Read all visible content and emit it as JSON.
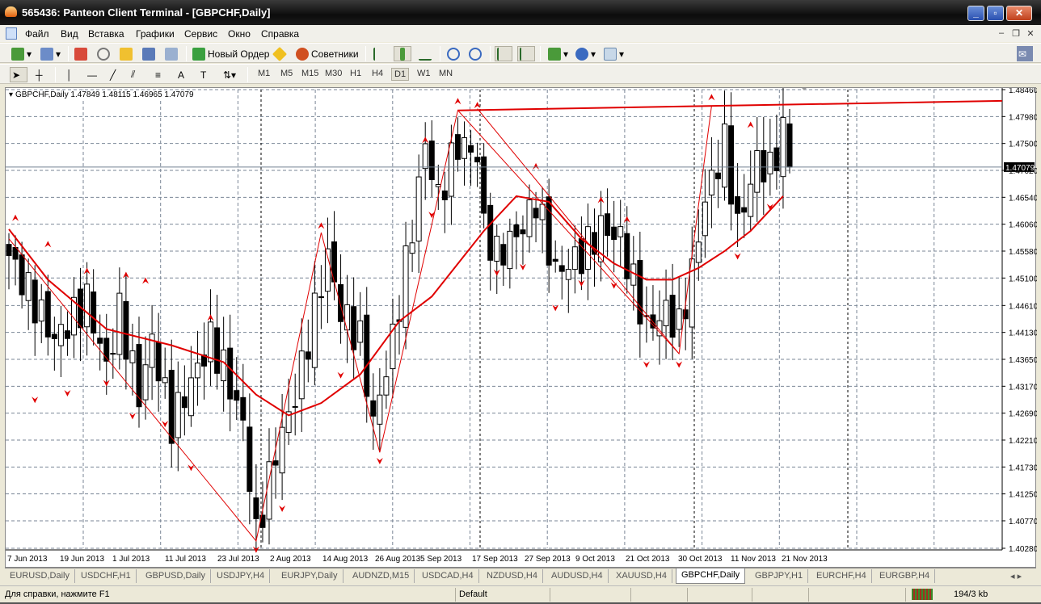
{
  "window": {
    "title": "565436: Panteon Client Terminal - [GBPCHF,Daily]"
  },
  "menu": [
    "Файл",
    "Вид",
    "Вставка",
    "Графики",
    "Сервис",
    "Окно",
    "Справка"
  ],
  "toolbar": {
    "new_order": "Новый Ордер",
    "experts": "Советники"
  },
  "timeframes": [
    "M1",
    "M5",
    "M15",
    "M30",
    "H1",
    "H4",
    "D1",
    "W1",
    "MN"
  ],
  "active_timeframe": "D1",
  "chart_header": "GBPCHF,Daily  1.47849 1.48115 1.46965 1.47079",
  "status": {
    "help": "Для справки, нажмите F1",
    "profile": "Default",
    "traffic": "194/3 kb"
  },
  "tabs": [
    "EURUSD,Daily",
    "USDCHF,H1",
    "GBPUSD,Daily",
    "USDJPY,H4",
    "EURJPY,Daily",
    "AUDNZD,M15",
    "USDCAD,H4",
    "NZDUSD,H4",
    "AUDUSD,H4",
    "XAUUSD,H4",
    "GBPCHF,Daily",
    "GBPJPY,H1",
    "EURCHF,H4",
    "EURGBP,H4"
  ],
  "active_tab": "GBPCHF,Daily",
  "chart_data": {
    "type": "candlestick",
    "symbol": "GBPCHF",
    "period": "Daily",
    "ohlc_last": {
      "open": 1.47849,
      "high": 1.48115,
      "low": 1.46965,
      "close": 1.47079
    },
    "current_price_label": "1.47079",
    "current_price": 1.47079,
    "ylim": [
      1.4028,
      1.4846
    ],
    "y_ticks": [
      "1.48460",
      "1.47980",
      "1.47500",
      "1.47020",
      "1.46540",
      "1.46060",
      "1.45580",
      "1.45100",
      "1.44610",
      "1.44130",
      "1.43650",
      "1.43170",
      "1.42690",
      "1.42210",
      "1.41730",
      "1.41250",
      "1.40770",
      "1.40280"
    ],
    "x_ticks": [
      "7 Jun 2013",
      "19 Jun 2013",
      "1 Jul 2013",
      "11 Jul 2013",
      "23 Jul 2013",
      "2 Aug 2013",
      "14 Aug 2013",
      "26 Aug 2013",
      "5 Sep 2013",
      "17 Sep 2013",
      "27 Sep 2013",
      "9 Oct 2013",
      "21 Oct 2013",
      "30 Oct 2013",
      "11 Nov 2013",
      "21 Nov 2013"
    ],
    "bar_count": 121,
    "close_anchors": [
      [
        0,
        1.455
      ],
      [
        7,
        1.44
      ],
      [
        12,
        1.447
      ],
      [
        15,
        1.435
      ],
      [
        17,
        1.445
      ],
      [
        20,
        1.43
      ],
      [
        22,
        1.44
      ],
      [
        25,
        1.425
      ],
      [
        29,
        1.435
      ],
      [
        31,
        1.44
      ],
      [
        33,
        1.435
      ],
      [
        36,
        1.425
      ],
      [
        38,
        1.405
      ],
      [
        41,
        1.42
      ],
      [
        44,
        1.43
      ],
      [
        47,
        1.445
      ],
      [
        49,
        1.455
      ],
      [
        51,
        1.445
      ],
      [
        54,
        1.44
      ],
      [
        56,
        1.425
      ],
      [
        59,
        1.44
      ],
      [
        62,
        1.46
      ],
      [
        64,
        1.475
      ],
      [
        66,
        1.465
      ],
      [
        69,
        1.475
      ],
      [
        72,
        1.473
      ],
      [
        73,
        1.46
      ],
      [
        75,
        1.455
      ],
      [
        79,
        1.46
      ],
      [
        81,
        1.465
      ],
      [
        84,
        1.452
      ],
      [
        88,
        1.455
      ],
      [
        91,
        1.46
      ],
      [
        94,
        1.458
      ],
      [
        96,
        1.45
      ],
      [
        98,
        1.442
      ],
      [
        101,
        1.445
      ],
      [
        103,
        1.442
      ],
      [
        105,
        1.452
      ],
      [
        107,
        1.465
      ],
      [
        110,
        1.475
      ],
      [
        112,
        1.46
      ],
      [
        115,
        1.472
      ],
      [
        117,
        1.47
      ],
      [
        119,
        1.477
      ],
      [
        120,
        1.47079
      ]
    ],
    "moving_average": [
      [
        0,
        1.4597
      ],
      [
        6,
        1.4507
      ],
      [
        15,
        1.4419
      ],
      [
        25,
        1.439
      ],
      [
        33,
        1.436
      ],
      [
        38,
        1.4302
      ],
      [
        43,
        1.4265
      ],
      [
        48,
        1.4287
      ],
      [
        54,
        1.4338
      ],
      [
        60,
        1.4433
      ],
      [
        65,
        1.4477
      ],
      [
        73,
        1.4594
      ],
      [
        78,
        1.4656
      ],
      [
        83,
        1.4646
      ],
      [
        88,
        1.458
      ],
      [
        93,
        1.4536
      ],
      [
        98,
        1.4507
      ],
      [
        102,
        1.4507
      ],
      [
        106,
        1.4528
      ],
      [
        110,
        1.4558
      ],
      [
        114,
        1.4594
      ],
      [
        119,
        1.4656
      ]
    ],
    "zigzag": [
      [
        0,
        1.458
      ],
      [
        38,
        1.4041
      ],
      [
        48,
        1.4591
      ],
      [
        57,
        1.4199
      ],
      [
        69,
        1.4809
      ],
      [
        103,
        1.4375
      ],
      [
        108,
        1.4817
      ]
    ],
    "zigzag2": [
      [
        72,
        1.4812
      ],
      [
        103,
        1.4375
      ]
    ],
    "trendline": [
      [
        69,
        1.4809
      ],
      [
        152,
        1.4826
      ]
    ],
    "fractals_up": [
      [
        1,
        1.4616
      ],
      [
        6,
        1.4569
      ],
      [
        12,
        1.4521
      ],
      [
        18,
        1.4514
      ],
      [
        21,
        1.4504
      ],
      [
        31,
        1.4438
      ],
      [
        48,
        1.4602
      ],
      [
        64,
        1.4755
      ],
      [
        69,
        1.4824
      ],
      [
        72,
        1.4817
      ],
      [
        81,
        1.4708
      ],
      [
        91,
        1.4648
      ],
      [
        95,
        1.4613
      ],
      [
        108,
        1.4831
      ],
      [
        114,
        1.4782
      ]
    ],
    "fractals_down": [
      [
        4,
        1.4294
      ],
      [
        9,
        1.4306
      ],
      [
        15,
        1.4324
      ],
      [
        19,
        1.4265
      ],
      [
        24,
        1.4251
      ],
      [
        28,
        1.4173
      ],
      [
        38,
        1.4027
      ],
      [
        42,
        1.41
      ],
      [
        51,
        1.4338
      ],
      [
        57,
        1.4185
      ],
      [
        65,
        1.4624
      ],
      [
        75,
        1.4521
      ],
      [
        79,
        1.4531
      ],
      [
        84,
        1.4458
      ],
      [
        88,
        1.4502
      ],
      [
        93,
        1.4498
      ],
      [
        98,
        1.4357
      ],
      [
        103,
        1.4357
      ],
      [
        112,
        1.455
      ],
      [
        117,
        1.4638
      ]
    ]
  }
}
